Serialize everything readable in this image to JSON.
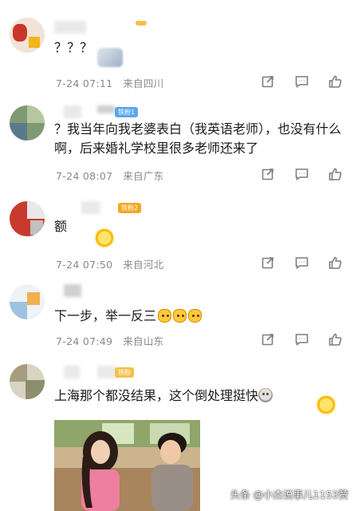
{
  "comments": [
    {
      "content": "？？？",
      "time": "7-24 07:11",
      "location": "来自四川"
    },
    {
      "badge": "铁粉1",
      "content": "？我当年向我老婆表白（我英语老师），也没有什么啊，后来婚礼学校里很多老师还来了",
      "time": "7-24 08:07",
      "location": "来自广东"
    },
    {
      "badge": "铁粉2",
      "content": "额",
      "time": "7-24 07:50",
      "location": "来自河北"
    },
    {
      "content": "下一步，举一反三",
      "time": "7-24 07:49",
      "location": "来自山东"
    },
    {
      "badge": "铁粉",
      "content": "上海那个都没结果，这个倒处理挺快"
    }
  ],
  "icons": {
    "share": "share-icon",
    "comment": "comment-icon",
    "like": "like-icon"
  },
  "watermark": "头条 @小杰说事儿1153赞",
  "colors": {
    "meta": "#8a8a8a",
    "icon": "#7d7d7d",
    "badge_blue": "#5aa7f0",
    "badge_orange": "#f5a623"
  }
}
